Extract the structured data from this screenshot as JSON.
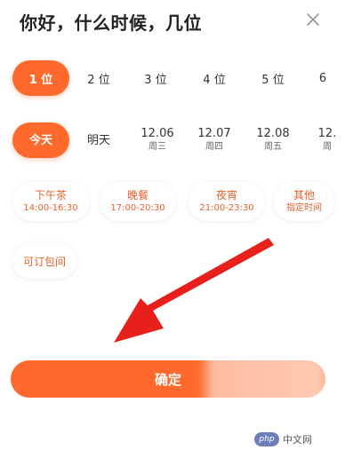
{
  "header": {
    "title": "你好，什么时候，几位"
  },
  "close_icon": "close-icon",
  "people": [
    "1 位",
    "2 位",
    "3 位",
    "4 位",
    "5 位",
    "6"
  ],
  "people_selected_index": 0,
  "dates": [
    {
      "main": "今天",
      "sub": ""
    },
    {
      "main": "明天",
      "sub": ""
    },
    {
      "main": "12.06",
      "sub": "周三"
    },
    {
      "main": "12.07",
      "sub": "周四"
    },
    {
      "main": "12.08",
      "sub": "周五"
    },
    {
      "main": "12.",
      "sub": "周"
    }
  ],
  "dates_selected_index": 0,
  "time_slots": [
    {
      "name": "下午茶",
      "time": "14:00-16:30"
    },
    {
      "name": "晚餐",
      "time": "17:00-20:30"
    },
    {
      "name": "夜宵",
      "time": "21:00-23:30"
    },
    {
      "name": "其他",
      "time": "指定时间"
    }
  ],
  "private_room": "可订包间",
  "confirm_label": "确定",
  "watermark": {
    "badge": "php",
    "text": "中文网"
  },
  "colors": {
    "accent": "#ff6a2c",
    "slot_text": "#e8602c",
    "annotation_arrow": "#e8201c"
  }
}
